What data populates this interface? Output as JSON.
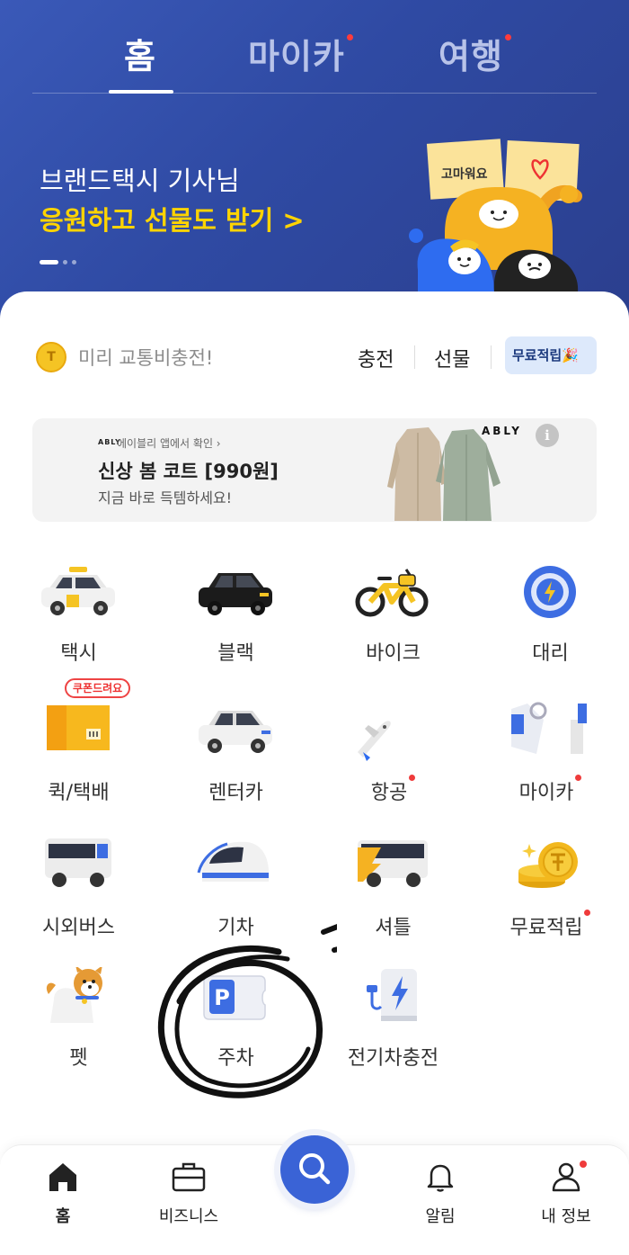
{
  "header": {
    "tabs": [
      {
        "label": "홈",
        "active": true,
        "has_dot": false
      },
      {
        "label": "마이카",
        "active": false,
        "has_dot": true
      },
      {
        "label": "여행",
        "active": false,
        "has_dot": true
      }
    ],
    "banner": {
      "line1": "브랜드택시 기사님",
      "line2": "응원하고 선물도 받기 >",
      "sign_text": "고마워요",
      "slide_index": 1,
      "slide_count": 3
    }
  },
  "wallet": {
    "coin_symbol": "T",
    "prompt": "미리 교통비충전!",
    "charge_label": "충전",
    "gift_label": "선물",
    "free_label": "무료적립🎉"
  },
  "ad": {
    "small_logo": "ABLY",
    "source": "에이블리 앱에서 확인 ›",
    "title": "신상 봄 코트 [990원]",
    "subtitle": "지금 바로 득템하세요!",
    "brand": "ABLY",
    "info_symbol": "i"
  },
  "services": [
    {
      "label": "택시",
      "icon": "taxi-icon",
      "dot": false
    },
    {
      "label": "블랙",
      "icon": "black-car-icon",
      "dot": false
    },
    {
      "label": "바이크",
      "icon": "bike-icon",
      "dot": false
    },
    {
      "label": "대리",
      "icon": "steering-wheel-icon",
      "dot": false
    },
    {
      "label": "퀵/택배",
      "icon": "parcel-box-icon",
      "dot": false
    },
    {
      "label": "렌터카",
      "icon": "rental-car-icon",
      "dot": false
    },
    {
      "label": "항공",
      "icon": "airplane-icon",
      "dot": true
    },
    {
      "label": "마이카",
      "icon": "mycar-icon",
      "dot": true
    },
    {
      "label": "시외버스",
      "icon": "bus-icon",
      "dot": false
    },
    {
      "label": "기차",
      "icon": "train-icon",
      "dot": false
    },
    {
      "label": "셔틀",
      "icon": "shuttle-icon",
      "dot": false
    },
    {
      "label": "무료적립",
      "icon": "coins-icon",
      "dot": true
    },
    {
      "label": "펫",
      "icon": "dog-icon",
      "dot": false
    },
    {
      "label": "주차",
      "icon": "parking-icon",
      "dot": false
    },
    {
      "label": "전기차충전",
      "icon": "ev-charger-icon",
      "dot": false
    }
  ],
  "coupon_badge": "쿠폰드려요",
  "bottom_nav": [
    {
      "label": "홈",
      "icon": "home-icon",
      "active": true
    },
    {
      "label": "비즈니스",
      "icon": "briefcase-icon",
      "active": false
    },
    {
      "label": "",
      "icon": "search-icon",
      "active": false
    },
    {
      "label": "알림",
      "icon": "bell-icon",
      "active": false
    },
    {
      "label": "내 정보",
      "icon": "person-icon",
      "active": false,
      "dot": true
    }
  ],
  "colors": {
    "header_blue": "#2f4aa3",
    "banner_yellow": "#ffd400",
    "accent_red": "#ef3b3b",
    "search_blue": "#3a63d6"
  }
}
